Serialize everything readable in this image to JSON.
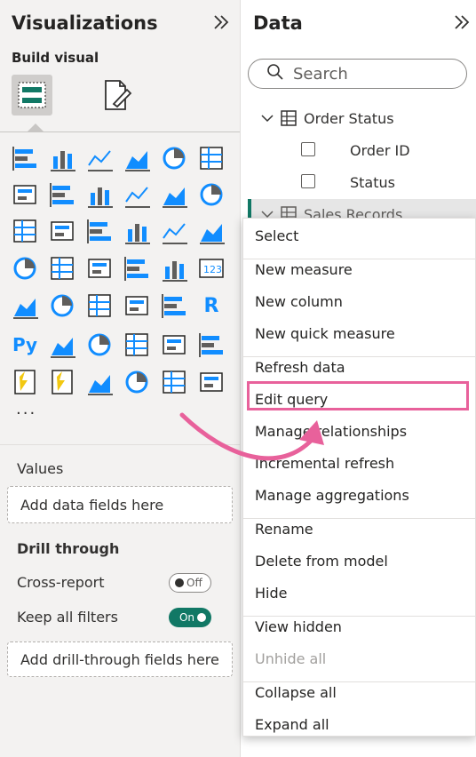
{
  "visualizations": {
    "title": "Visualizations",
    "expand_icon": "double-chevron-right-icon",
    "build_visual": "Build visual",
    "tools": [
      "build-visual-icon",
      "format-visual-icon"
    ],
    "visual_icons": [
      "stacked-bar-chart-icon",
      "stacked-column-chart-icon",
      "clustered-bar-chart-icon",
      "clustered-column-chart-icon",
      "100-stacked-bar-chart-icon",
      "100-stacked-column-chart-icon",
      "line-chart-icon",
      "area-chart-icon",
      "stacked-area-chart-icon",
      "100-stacked-area-chart-icon",
      "line-and-stacked-column-icon",
      "line-and-clustered-column-icon",
      "ribbon-chart-icon",
      "waterfall-chart-icon",
      "funnel-icon",
      "scatter-chart-icon",
      "pie-chart-icon",
      "donut-chart-icon",
      "treemap-icon",
      "map-icon",
      "filled-map-icon",
      "azure-map-icon",
      "gauge-icon",
      "card-icon",
      "multi-row-card-icon",
      "kpi-icon",
      "slicer-icon",
      "table-icon",
      "matrix-icon",
      "r-visual-icon",
      "python-visual-icon",
      "key-influencers-icon",
      "decomposition-tree-icon",
      "qna-icon",
      "smart-narrative-icon",
      "metrics-icon",
      "paginated-report-icon",
      "power-automate-icon",
      "power-apps-icon",
      "arcgis-icon",
      "power-apps-diamond-icon",
      "power-automate-arrow-icon"
    ],
    "more": "···",
    "values_label": "Values",
    "values_placeholder": "Add data fields here",
    "drill_label": "Drill through",
    "cross_report_label": "Cross-report",
    "cross_report_toggle": "Off",
    "keep_filters_label": "Keep all filters",
    "keep_filters_toggle": "On",
    "drill_placeholder": "Add drill-through fields here"
  },
  "data": {
    "title": "Data",
    "search_placeholder": "Search",
    "tables": [
      {
        "name": "Order Status",
        "fields": [
          "Order ID",
          "Status"
        ]
      },
      {
        "name": "Sales Records"
      }
    ]
  },
  "context_menu": {
    "groups": [
      [
        "Select"
      ],
      [
        "New measure",
        "New column",
        "New quick measure"
      ],
      [
        "Refresh data",
        "Edit query",
        "Manage relationships",
        "Incremental refresh",
        "Manage aggregations"
      ],
      [
        "Rename",
        "Delete from model",
        "Hide"
      ],
      [
        "View hidden",
        "Unhide all"
      ],
      [
        "Collapse all",
        "Expand all"
      ]
    ],
    "highlighted": "Edit query",
    "highlight_color": "#e8619b"
  },
  "colors": {
    "accent_teal": "#117865",
    "accent_blue": "#118dff",
    "brand_yellow": "#f2c811"
  }
}
